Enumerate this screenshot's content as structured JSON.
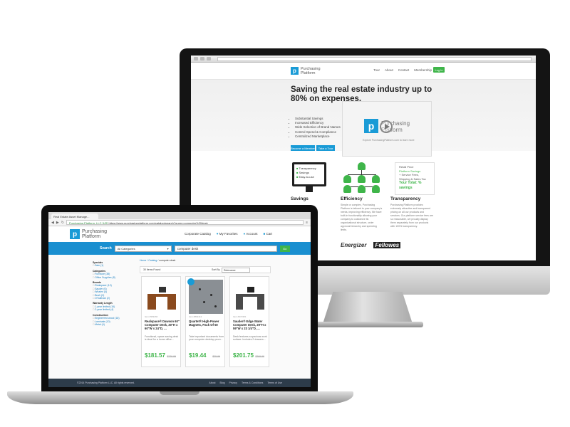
{
  "desktop": {
    "logo_mark": "p",
    "logo_text": "Purchasing Platform",
    "nav": [
      "Tour",
      "About",
      "Contact",
      "Membership"
    ],
    "login": "Log In",
    "headline": "Saving the real estate industry up to 80% on expenses.",
    "bullets": [
      "Substantial Savings",
      "Increased Efficiency",
      "Wide Selection of Brand Names",
      "Control Spend & Compliance",
      "Centralized Marketplace"
    ],
    "cta_primary": "Become a Member",
    "cta_secondary": "Take a Tour",
    "video_title": "Purchasing Platform",
    "video_caption": "Explore PurchasingPlatform.com to learn more",
    "monitor_list": [
      "Transparency",
      "Savings",
      "Easy-to-use"
    ],
    "receipt_lines": [
      "Retail Price",
      "Platform Savings",
      "+ Service Fees, Shipping & Sales Tax",
      "Your Total: "
    ],
    "receipt_total": "% savings",
    "columns": [
      {
        "title": "Savings",
        "text": ""
      },
      {
        "title": "Efficiency",
        "text": "Simple or complex, Purchasing Platform is tailored to your company's needs, improving efficiency. We have built-in functionality allowing your company to customize its organizational structure, order approval hierarchy and spending limits."
      },
      {
        "title": "Transparency",
        "text": "Purchasing Platform provides extremely attractive and transparent pricing on all our products and services. Our platform service fees are so reasonable, we proudly display them separately from our products with 100% transparency."
      }
    ],
    "brands": [
      "Energizer",
      "Fellowes"
    ]
  },
  "laptop": {
    "tab_title": "Real Estate Asset Manage...",
    "address_secure": "Purchasing Platform, LLC [US]",
    "address_url": "https://www.purchasingplatform.com/catalog/search?query=computer%20desk",
    "logo_mark": "p",
    "logo_text": "Purchasing Platform",
    "menu": [
      "Corporate Catalog",
      "My Favorites",
      "Account",
      "Cart"
    ],
    "search_label": "Search",
    "search_category": "All Categories",
    "search_query": "computer desk",
    "search_go": "Go",
    "breadcrumb_home": "Home",
    "breadcrumb_catalog": "Catalog",
    "breadcrumb_term": "computer desk",
    "items_found": "30 Items Found",
    "sort_label": "Sort By",
    "sort_value": "Relevance",
    "sidebar": {
      "specials_heading": "Specials",
      "specials": [
        "Sale (1)"
      ],
      "categories_heading": "Categories",
      "categories": [
        "Furniture (38)",
        "Office Supplies (8)"
      ],
      "brands_heading": "Brands",
      "brands": [
        "Realspace (12)",
        "Sauder (6)",
        "Whalen (4)",
        "Bush (3)",
        "O'Sullivan (2)"
      ],
      "warranty_heading": "Warranty Length",
      "warranty": [
        "1-year limited (16)",
        "2-year limited (4)"
      ],
      "construction_heading": "Construction",
      "construction": [
        "Engineered wood (18)",
        "Laminate (10)",
        "Metal (4)"
      ]
    },
    "products": [
      {
        "sku": "Item #953260",
        "title": "Realspace® Dawson 60\" Computer Desk, 30\"H x 60\"W x 24\"D, ...",
        "desc": "Functional, space-saving desk is ideal for a home office...",
        "price": "$181.57",
        "old": "$229.99"
      },
      {
        "sku": "Item #802412",
        "title": "Quartet® High-Power Magnets, Pack Of 50",
        "desc": "Take important documents from your computer desktop prom...",
        "price": "$19.44",
        "old": "$25.99"
      },
      {
        "sku": "Item #371951",
        "title": "Sauder® Edge Water Computer Desk, 29\"H x 59\"W x 23 1/4\"D, ...",
        "desc": "Desk features a spacious work surface. Includes 2 drawers...",
        "price": "$201.75",
        "old": "$269.99"
      }
    ],
    "footer_copy": "©2014 Purchasing Platform LLC. All rights reserved.",
    "footer_links": [
      "About",
      "Blog",
      "Privacy",
      "Terms & Conditions",
      "Terms of Use"
    ]
  },
  "colors": {
    "brand_blue": "#1a9bd6",
    "price_green": "#3fb54a",
    "footer": "#2d3c4a"
  }
}
